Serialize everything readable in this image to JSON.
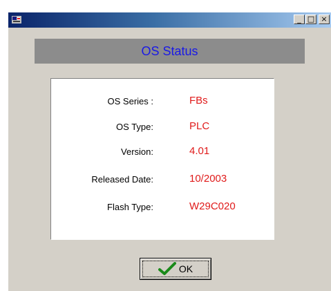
{
  "window": {
    "title": "",
    "controls": {
      "minimize": "_",
      "maximize": "□",
      "close": "×"
    }
  },
  "header": {
    "title": "OS Status",
    "title_color": "#1919e6"
  },
  "info": {
    "value_color": "#e01a1a",
    "rows": [
      {
        "label": "OS Series :",
        "value": "FBs"
      },
      {
        "label": "OS Type:",
        "value": "PLC"
      },
      {
        "label": "Version:",
        "value": "4.01"
      },
      {
        "label": "Released Date:",
        "value": "10/2003"
      },
      {
        "label": "Flash Type:",
        "value": "W29C020"
      }
    ]
  },
  "buttons": {
    "ok_label": "OK",
    "ok_icon": "checkmark-icon"
  }
}
